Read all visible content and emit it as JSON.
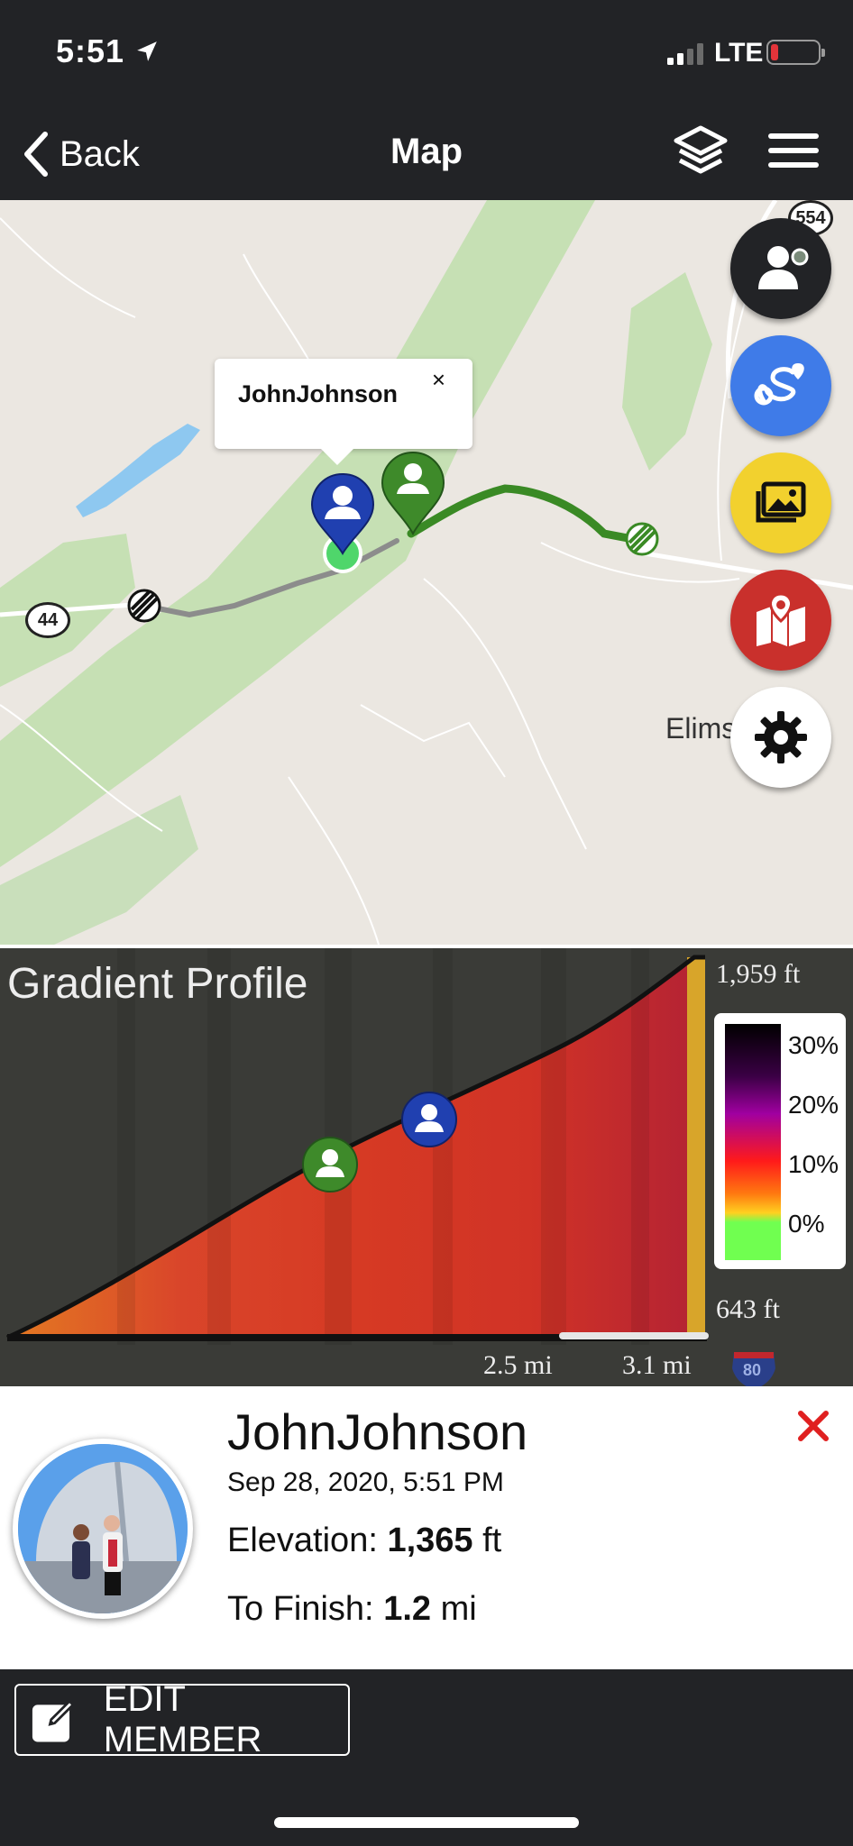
{
  "status_bar": {
    "time": "5:51",
    "network": "LTE",
    "icons": [
      "location-arrow-icon",
      "signal-icon",
      "battery-icon"
    ],
    "battery_color": "#e3343a"
  },
  "nav": {
    "back_label": "Back",
    "title": "Map",
    "icons": [
      "chevron-left-icon",
      "layers-icon",
      "hamburger-menu-icon"
    ]
  },
  "map": {
    "town_label": "Elims",
    "route_shields": [
      "554",
      "44"
    ],
    "popup": {
      "name": "JohnJohnson",
      "close": "×"
    },
    "fab_buttons": [
      {
        "name": "members",
        "icon": "member-icon",
        "color": "#222326"
      },
      {
        "name": "route",
        "icon": "route-icon",
        "color": "#3f7be8"
      },
      {
        "name": "photos",
        "icon": "gallery-icon",
        "color": "#f2d12e"
      },
      {
        "name": "map-points",
        "icon": "map-pin-icon",
        "color": "#c9302c"
      },
      {
        "name": "settings",
        "icon": "gear-icon",
        "color": "#ffffff"
      }
    ],
    "colors": {
      "route_done": "#3a8a25",
      "route_remaining": "#8c8c8c",
      "forest": "#c6e0b4",
      "water": "#8ec8f0"
    }
  },
  "gradient_profile": {
    "title": "Gradient Profile",
    "max_elevation": "1,959 ft",
    "min_elevation": "643 ft",
    "distance_labels": [
      "2.5 mi",
      "3.1 mi"
    ],
    "legend": [
      "30%",
      "20%",
      "10%",
      "0%"
    ],
    "interstate": "80"
  },
  "member": {
    "name": "JohnJohnson",
    "datetime": "Sep 28, 2020, 5:51 PM",
    "elevation_label": "Elevation:",
    "elevation_value": "1,365",
    "elevation_unit": "ft",
    "finish_label": "To Finish:",
    "finish_value": "1.2",
    "finish_unit": "mi",
    "close_color": "#e02020"
  },
  "bottom": {
    "edit_label": "EDIT MEMBER"
  }
}
